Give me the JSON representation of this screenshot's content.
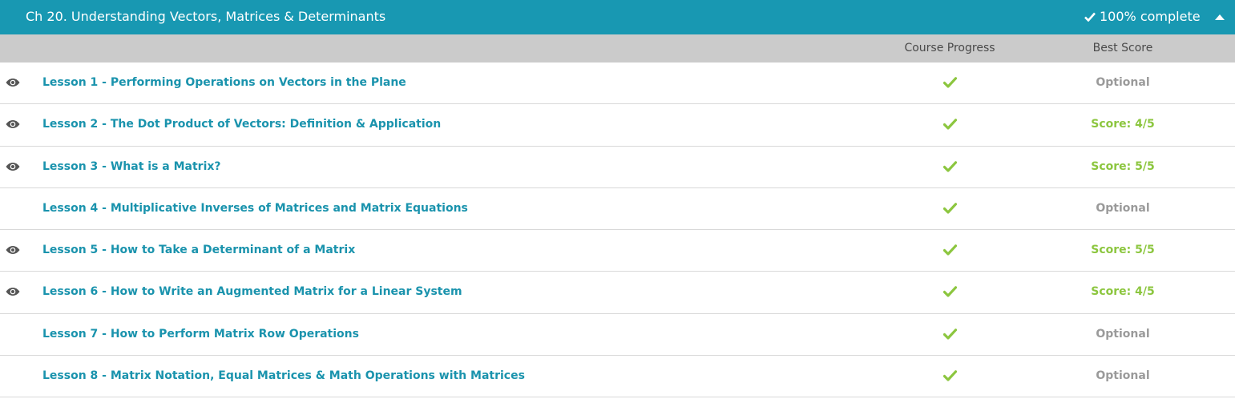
{
  "chapter": {
    "title": "Ch 20. Understanding Vectors, Matrices & Determinants",
    "completion": "100% complete",
    "accent_color": "#1898b2"
  },
  "columns": {
    "progress": "Course Progress",
    "best_score": "Best Score"
  },
  "lessons": [
    {
      "title": "Lesson 1 - Performing Operations on Vectors in the Plane",
      "has_video": true,
      "completed": true,
      "score": "Optional",
      "score_type": "optional"
    },
    {
      "title": "Lesson 2 - The Dot Product of Vectors: Definition & Application",
      "has_video": true,
      "completed": true,
      "score": "Score: 4/5",
      "score_type": "graded"
    },
    {
      "title": "Lesson 3 - What is a Matrix?",
      "has_video": true,
      "completed": true,
      "score": "Score: 5/5",
      "score_type": "graded"
    },
    {
      "title": "Lesson 4 - Multiplicative Inverses of Matrices and Matrix Equations",
      "has_video": false,
      "completed": true,
      "score": "Optional",
      "score_type": "optional"
    },
    {
      "title": "Lesson 5 - How to Take a Determinant of a Matrix",
      "has_video": true,
      "completed": true,
      "score": "Score: 5/5",
      "score_type": "graded"
    },
    {
      "title": "Lesson 6 - How to Write an Augmented Matrix for a Linear System",
      "has_video": true,
      "completed": true,
      "score": "Score: 4/5",
      "score_type": "graded"
    },
    {
      "title": "Lesson 7 - How to Perform Matrix Row Operations",
      "has_video": false,
      "completed": true,
      "score": "Optional",
      "score_type": "optional"
    },
    {
      "title": "Lesson 8 - Matrix Notation, Equal Matrices & Math Operations with Matrices",
      "has_video": false,
      "completed": true,
      "score": "Optional",
      "score_type": "optional"
    }
  ],
  "icons": {
    "video": "eye-icon",
    "completed": "checkmark-icon",
    "collapse": "caret-up-icon"
  },
  "colors": {
    "link": "#1a93ad",
    "check": "#8cc63f",
    "optional": "#9a9a9a",
    "header_bar": "#cbcbcb"
  }
}
